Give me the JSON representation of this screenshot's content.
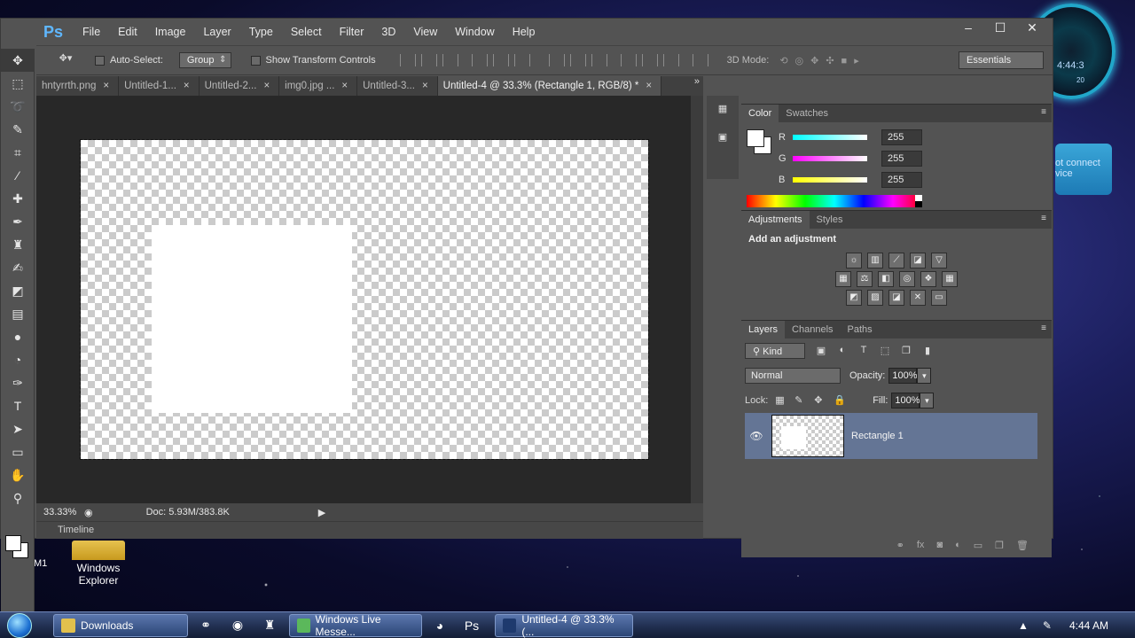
{
  "app": {
    "logo": "Ps",
    "menu": [
      "File",
      "Edit",
      "Image",
      "Layer",
      "Type",
      "Select",
      "Filter",
      "3D",
      "View",
      "Window",
      "Help"
    ],
    "window_buttons": [
      "–",
      "☐",
      "✕"
    ]
  },
  "options_bar": {
    "auto_select_label": "Auto-Select:",
    "auto_select_value": "Group",
    "transform_label": "Show Transform Controls",
    "mode_3d_label": "3D Mode:",
    "workspace": "Essentials"
  },
  "tabs": [
    {
      "label": "hntyrrth.png",
      "active": false
    },
    {
      "label": "Untitled-1...",
      "active": false
    },
    {
      "label": "Untitled-2...",
      "active": false
    },
    {
      "label": "img0.jpg ...",
      "active": false
    },
    {
      "label": "Untitled-3...",
      "active": false
    },
    {
      "label": "Untitled-4 @ 33.3% (Rectangle 1, RGB/8) *",
      "active": true
    }
  ],
  "status": {
    "zoom": "33.33%",
    "doc_info": "Doc: 5.93M/383.8K",
    "timeline_label": "Timeline"
  },
  "color_panel": {
    "tabs": [
      "Color",
      "Swatches"
    ],
    "r_label": "R",
    "r_value": "255",
    "g_label": "G",
    "g_value": "255",
    "b_label": "B",
    "b_value": "255"
  },
  "adjustments_panel": {
    "tabs": [
      "Adjustments",
      "Styles"
    ],
    "title": "Add an adjustment"
  },
  "layers_panel": {
    "tabs": [
      "Layers",
      "Channels",
      "Paths"
    ],
    "kind": "Kind",
    "blend_mode": "Normal",
    "opacity_label": "Opacity:",
    "opacity_value": "100%",
    "lock_label": "Lock:",
    "fill_label": "Fill:",
    "fill_value": "100%",
    "layer_name": "Rectangle 1"
  },
  "desktop": {
    "icon_label_line1": "Windows",
    "icon_label_line2": "Explorer",
    "clock_widget_time": "4:44:3",
    "clock_widget_num": "20",
    "gadget_text_line1": "ot connect",
    "gadget_text_line2": "vice",
    "m1": "M1"
  },
  "taskbar": {
    "items": [
      "Downloads",
      "Windows Live Messe...",
      "Untitled-4 @ 33.3% (..."
    ],
    "clock": "4:44 AM"
  },
  "colors": {
    "selected_layer": "#647595",
    "ui_gray": "#535353",
    "canvas_bg": "#282828"
  }
}
